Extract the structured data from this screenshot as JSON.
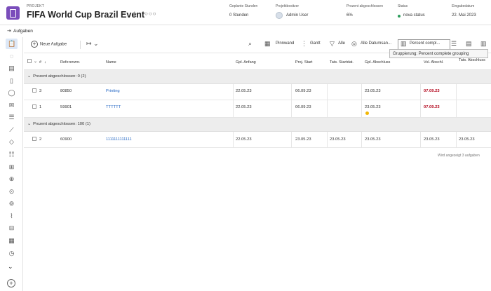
{
  "header": {
    "project_label": "PROJEKT",
    "project_title": "FIFA World Cup Brazil Event",
    "columns": [
      {
        "label": "Geplante Stunden",
        "value": "0 Stunden"
      },
      {
        "label": "Projektbesitzer",
        "value": "Admin User"
      },
      {
        "label": "Prozent abgeschlossen",
        "value": "6%"
      },
      {
        "label": "Status",
        "value": "nova status"
      },
      {
        "label": "Eingabedatum",
        "value": "22. Mai 2023"
      }
    ],
    "status_color": "#2d9d5c",
    "brand_color": "#7a4dbb"
  },
  "subheader": {
    "title": "Aufgaben"
  },
  "sidebar": {
    "icons": [
      "clipboard-icon",
      "chat-icon",
      "document-icon",
      "file-icon",
      "comment-icon",
      "mail-icon",
      "list-icon",
      "chart-icon",
      "diamond-icon",
      "users-icon",
      "team-icon",
      "people-icon",
      "person-icon",
      "group-icon",
      "trend-icon",
      "calendar-icon",
      "clock-icon"
    ]
  },
  "toolbar": {
    "new_task": "Neue Aufgabe",
    "pinnwand": "Pinnwand",
    "gantt": "Gantt",
    "filter": "Alle",
    "view": "Alle Datumsan...",
    "grouping": "Percent compl...",
    "tooltip": "Gruppierung: Percent complete grouping"
  },
  "table": {
    "headers": {
      "number": "#",
      "ref": "Referenznr.",
      "name": "Name",
      "planned_start": "Gpl. Anfang",
      "proj_start": "Proj. Start",
      "actual_start": "Tats. Startdat.",
      "planned_end": "Gpl. Abschluss",
      "expected_end": "Vsl. Abschl.",
      "actual_end": "Tats. Abschluss"
    },
    "groups": [
      {
        "label": "Prozent abgeschlossen: 0 (2)",
        "rows": [
          {
            "num": "3",
            "ref": "80850",
            "name": "Printing",
            "planned_start": "22.05.23",
            "proj_start": "06.09.23",
            "actual_start": "",
            "planned_end": "23.05.23",
            "expected_end": "07.09.23",
            "actual_end": ""
          },
          {
            "num": "1",
            "ref": "59901",
            "name": "TTTTTT",
            "planned_start": "22.05.23",
            "proj_start": "06.09.23",
            "actual_start": "",
            "planned_end": "23.05.23",
            "expected_end": "07.09.23",
            "actual_end": ""
          }
        ]
      },
      {
        "label": "Prozent abgeschlossen: 100 (1)",
        "rows": [
          {
            "num": "2",
            "ref": "60900",
            "name": "1111111111111",
            "planned_start": "22.05.23",
            "proj_start": "23.05.23",
            "actual_start": "23.05.23",
            "planned_end": "23.05.23",
            "expected_end": "23.05.23",
            "actual_end": "23.05.23"
          }
        ]
      }
    ],
    "footnote": "Wird angezeigt 3 aufgaben",
    "late_color": "#b3061c",
    "link_color": "#2367c4"
  }
}
